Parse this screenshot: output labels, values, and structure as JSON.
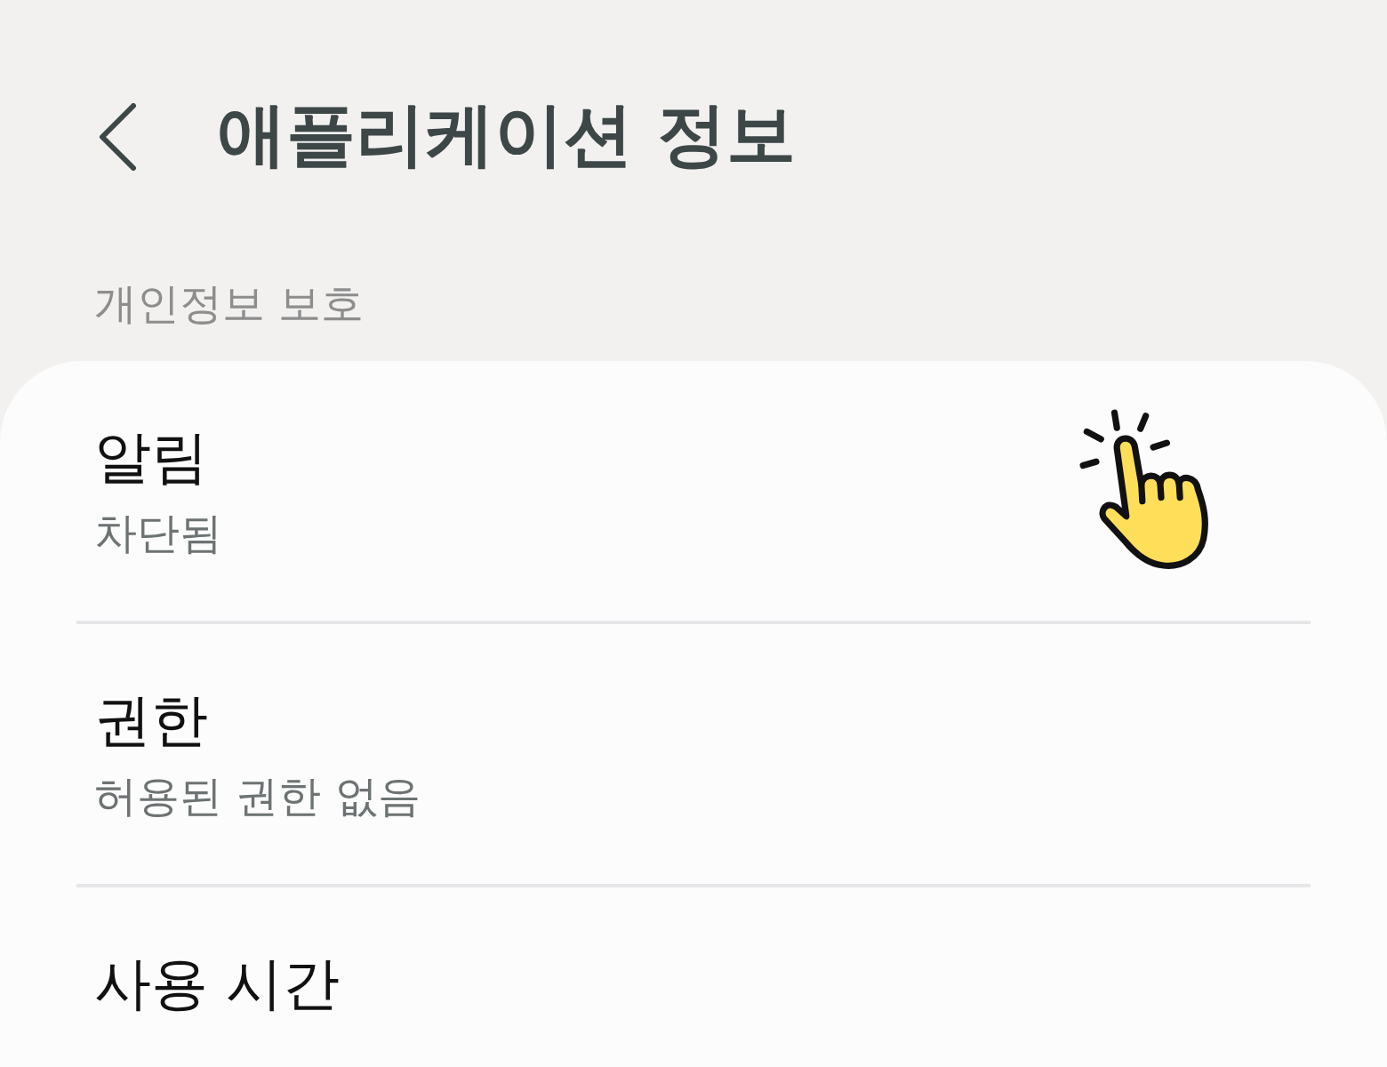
{
  "header": {
    "title": "애플리케이션 정보"
  },
  "section": {
    "label": "개인정보 보호"
  },
  "items": [
    {
      "title": "알림",
      "summary": "차단됨"
    },
    {
      "title": "권한",
      "summary": "허용된 권한 없음"
    },
    {
      "title": "사용 시간"
    }
  ]
}
